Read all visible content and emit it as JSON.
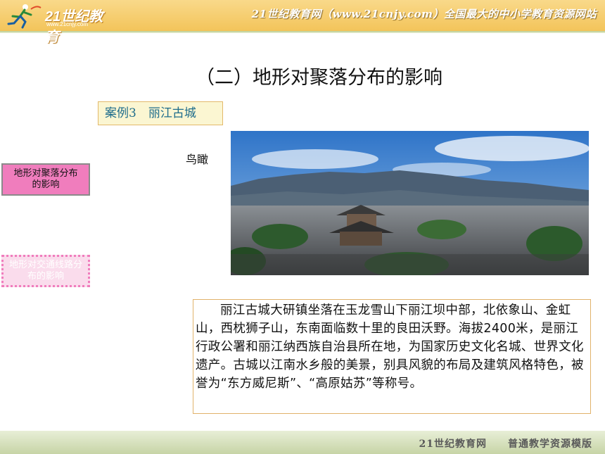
{
  "header": {
    "logo_text": "21世纪教育",
    "logo_url": "www.21cnjy.com",
    "slogan": "21世纪教育网（www.21cnjy.com）全国最大的中小学教育资源网站"
  },
  "slide": {
    "title": "（二）地形对聚落分布的影响",
    "case_label": "案例3　丽江古城",
    "birdseye_label": "鸟瞰",
    "description": "丽江古城大研镇坐落在玉龙雪山下丽江坝中部，北依象山、金虹山，西枕狮子山，东南面临数十里的良田沃野。海拔2400米，是丽江行政公署和丽江纳西族自治县所在地，为国家历史文化名城、世界文化遗产。古城以江南水乡般的美景，别具风貌的布局及建筑风格特色，被誉为“东方威尼斯”、“高原姑苏”等称号。"
  },
  "nav": {
    "items": [
      {
        "label": "地形对聚落分布的影响",
        "active": true
      },
      {
        "label": "地形对交通线路分布的影响",
        "active": false
      }
    ]
  },
  "footer": {
    "text": "21世纪教育网　　普通教学资源模版"
  },
  "colors": {
    "header_orange": "#f3c45a",
    "nav_active": "#f07dbd",
    "nav_inactive": "#fadcec",
    "case_text": "#1f6d8c"
  }
}
